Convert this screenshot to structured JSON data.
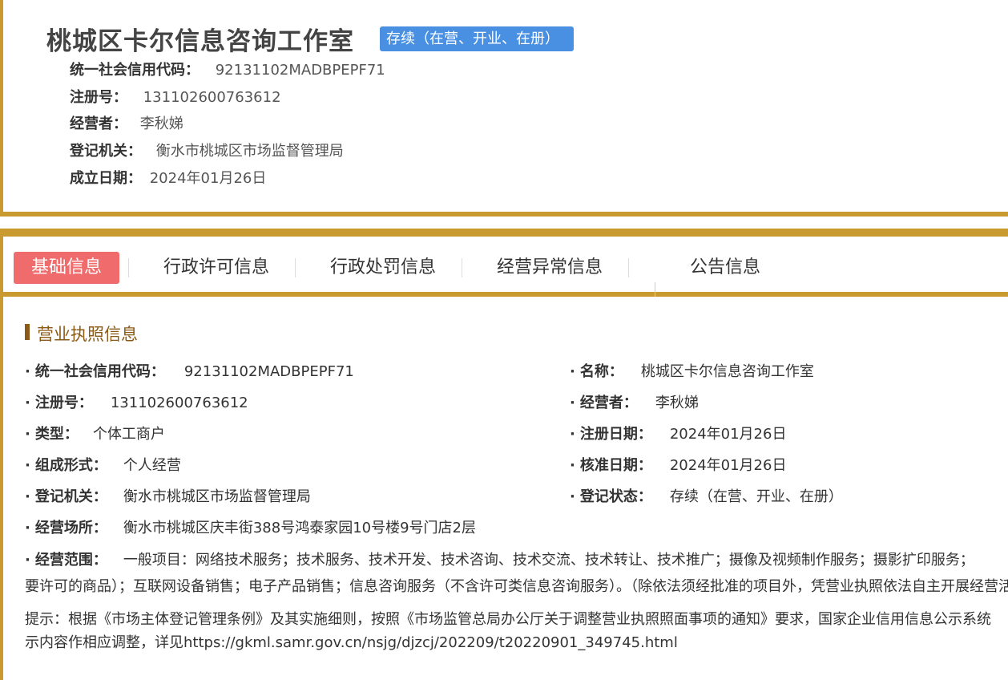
{
  "header": {
    "company_name": "桃城区卡尔信息咨询工作室",
    "status": "存续（在营、开业、在册）",
    "summary": [
      {
        "label": "统一社会信用代码：",
        "value": "92131102MADBPEPF71"
      },
      {
        "label": "注册号：",
        "value": "131102600763612"
      },
      {
        "label": "经营者：",
        "value": "李秋娣"
      },
      {
        "label": "登记机关：",
        "value": "衡水市桃城区市场监督管理局"
      },
      {
        "label": "成立日期：",
        "value": "2024年01月26日"
      }
    ]
  },
  "tabs": [
    {
      "label": "基础信息",
      "active": true
    },
    {
      "label": "行政许可信息",
      "active": false
    },
    {
      "label": "行政处罚信息",
      "active": false
    },
    {
      "label": "经营异常信息",
      "active": false
    },
    {
      "label": "公告信息",
      "active": false
    }
  ],
  "license": {
    "section_title": "营业执照信息",
    "bullet": "·",
    "fields": [
      {
        "label": "统一社会信用代码：",
        "value": "92131102MADBPEPF71"
      },
      {
        "label": "名称：",
        "value": "桃城区卡尔信息咨询工作室"
      },
      {
        "label": "注册号：",
        "value": "131102600763612"
      },
      {
        "label": "经营者：",
        "value": "李秋娣"
      },
      {
        "label": "类型：",
        "value": "个体工商户"
      },
      {
        "label": "注册日期：",
        "value": "2024年01月26日"
      },
      {
        "label": "组成形式：",
        "value": "个人经营"
      },
      {
        "label": "核准日期：",
        "value": "2024年01月26日"
      },
      {
        "label": "登记机关：",
        "value": "衡水市桃城区市场监督管理局"
      },
      {
        "label": "登记状态：",
        "value": "存续（在营、开业、在册）"
      },
      {
        "label": "经营场所：",
        "value": "衡水市桃城区庆丰街388号鸿泰家园10号楼9号门店2层"
      }
    ],
    "scope_label": "经营范围：",
    "scope_line1": "一般项目：网络技术服务；技术服务、技术开发、技术咨询、技术交流、技术转让、技术推广；摄像及视频制作服务；摄影扩印服务；",
    "scope_line2": "要许可的商品）；互联网设备销售；电子产品销售；信息咨询服务（不含许可类信息咨询服务）。（除依法须经批准的项目外，凭营业执照依法自主开展经营活动）",
    "notice_line1": "提示：根据《市场主体登记管理条例》及其实施细则，按照《市场监管总局办公厅关于调整营业执照照面事项的通知》要求，国家企业信用信息公示系统",
    "notice_line2": "示内容作相应调整，详见https://gkml.samr.gov.cn/nsjg/djzcj/202209/t20220901_349745.html"
  }
}
